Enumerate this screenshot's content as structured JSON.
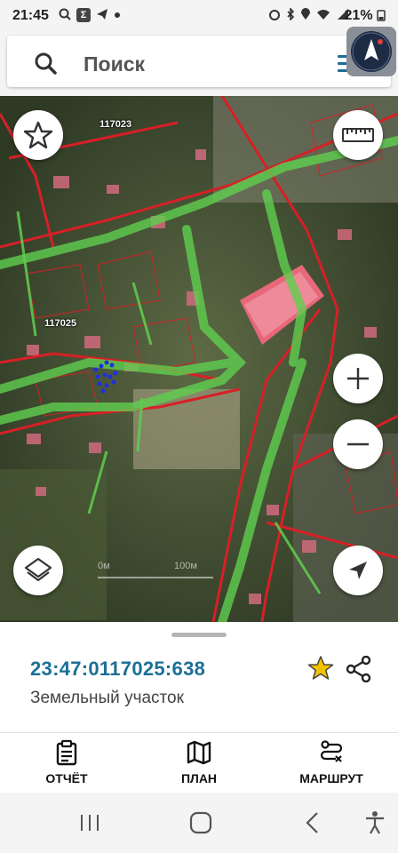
{
  "status_bar": {
    "time": "21:45",
    "battery": "21%",
    "left_icons": [
      "search-icon",
      "sigma-app-icon",
      "telegram-icon",
      "dot"
    ],
    "right_icons": [
      "alarm-icon",
      "bluetooth-icon",
      "location-icon",
      "wifi-icon",
      "signal-icon"
    ]
  },
  "search": {
    "placeholder": "Поиск"
  },
  "map": {
    "labels": {
      "block_a": "117023",
      "block_b": "117025"
    },
    "scale": {
      "left": "0м",
      "right": "100м"
    }
  },
  "parcel": {
    "cadastral_number": "23:47:0117025:638",
    "type": "Земельный участок"
  },
  "tabs": [
    {
      "label": "ОТЧЁТ",
      "icon": "report-clipboard-icon"
    },
    {
      "label": "ПЛАН",
      "icon": "map-plan-icon"
    },
    {
      "label": "МАРШРУТ",
      "icon": "route-icon"
    }
  ],
  "colors": {
    "accent": "#1c6f95",
    "favorite_star": "#f2c200",
    "parcel_border_red": "#d81f26",
    "zone_green": "#5fcf4f"
  }
}
